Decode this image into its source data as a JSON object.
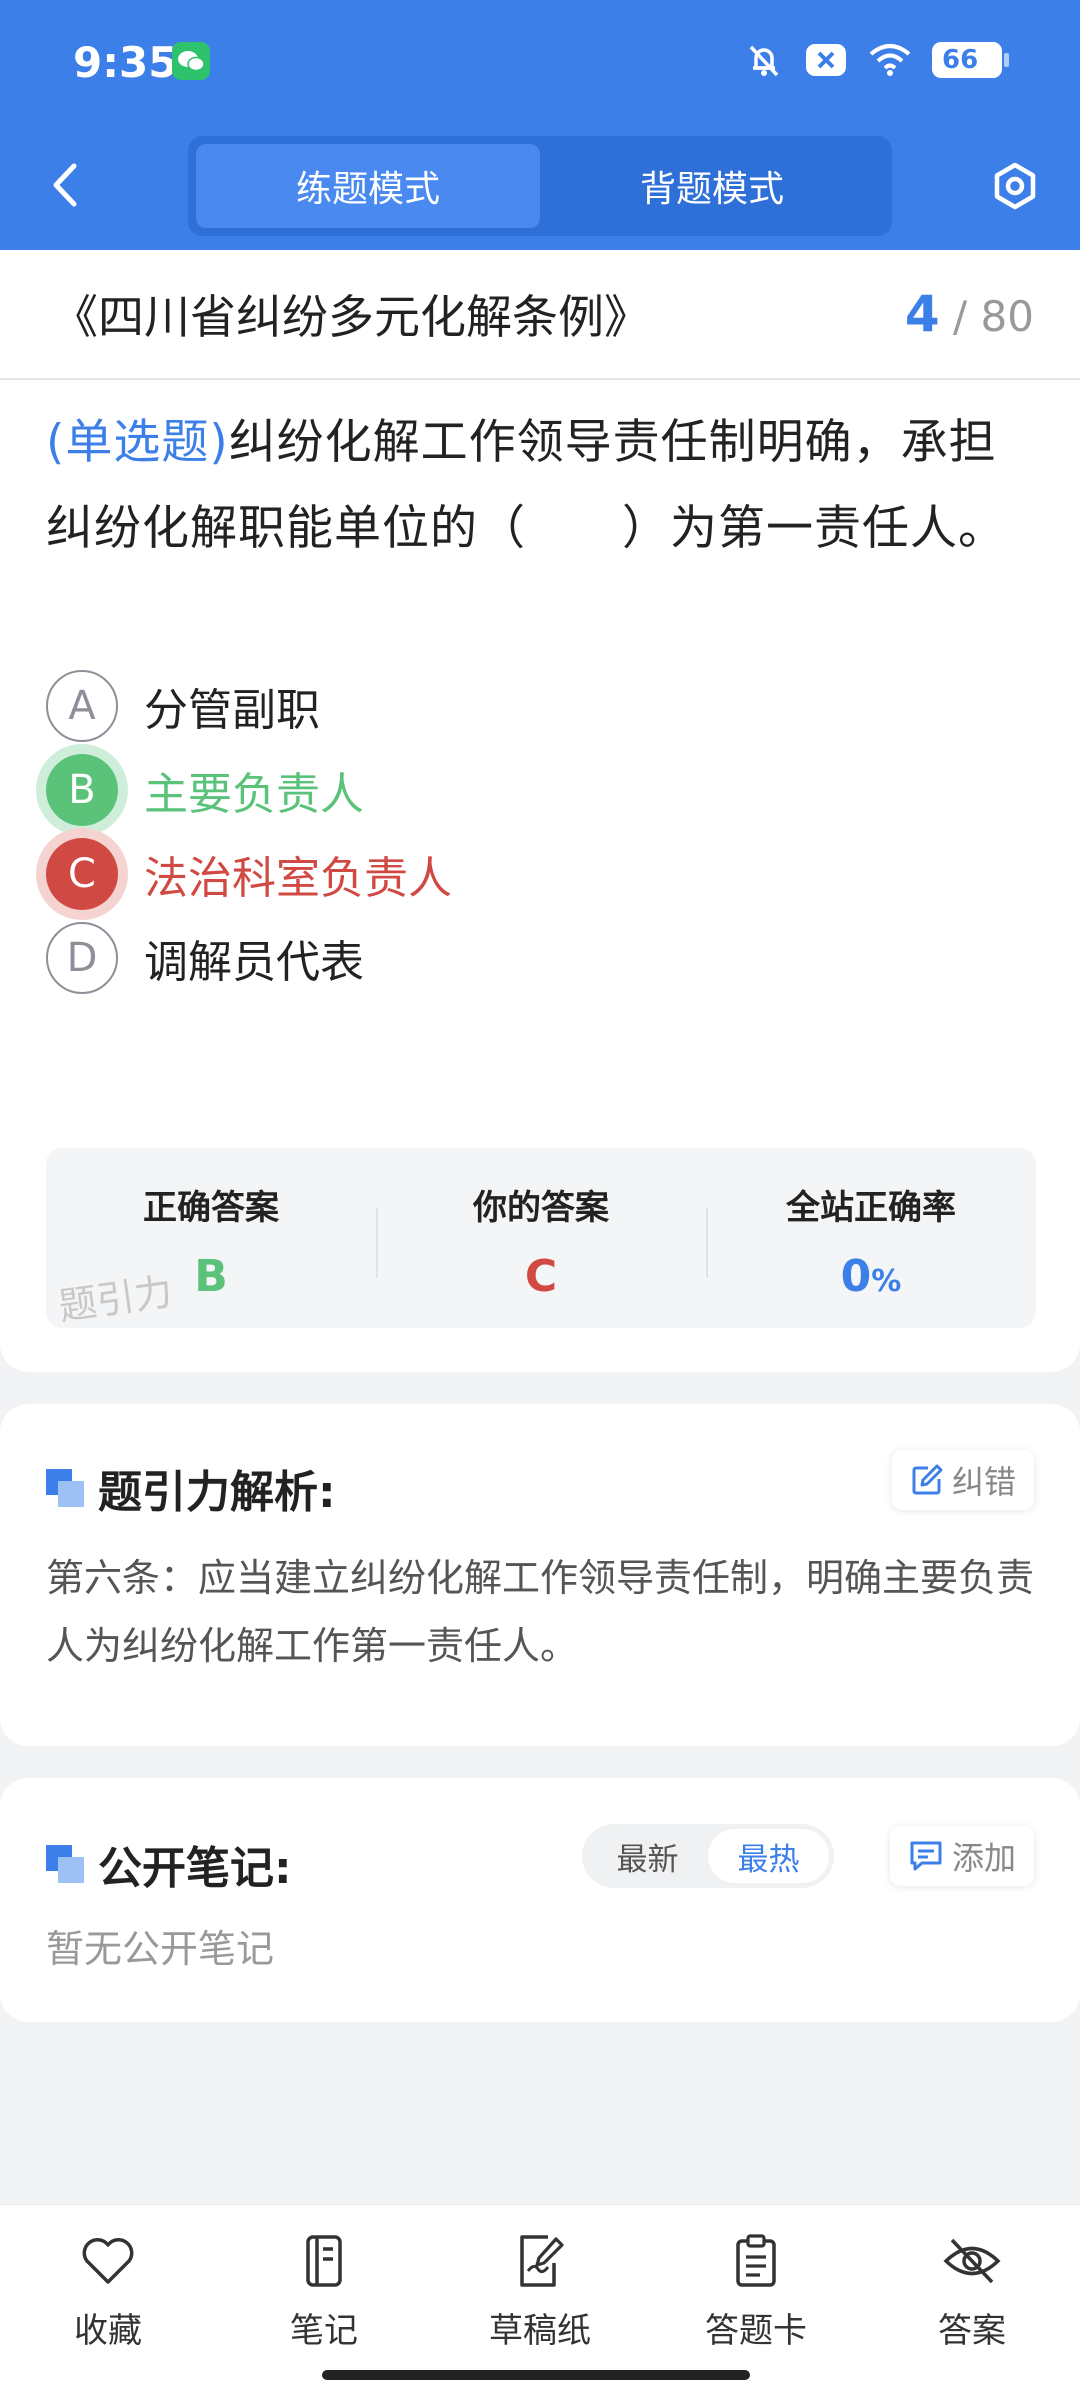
{
  "status": {
    "time": "9:35",
    "battery": "66"
  },
  "header": {
    "tabs": [
      {
        "label": "练题模式",
        "active": true
      },
      {
        "label": "背题模式",
        "active": false
      }
    ]
  },
  "question": {
    "book_title": "《四川省纠纷多元化解条例》",
    "current": "4",
    "separator": "/",
    "total": "80",
    "type_label": "(单选题)",
    "text": "纠纷化解工作领导责任制明确，承担纠纷化解职能单位的（　　）为第一责任人。",
    "options": [
      {
        "letter": "A",
        "text": "分管副职",
        "state": "normal"
      },
      {
        "letter": "B",
        "text": "主要负责人",
        "state": "correct"
      },
      {
        "letter": "C",
        "text": "法治科室负责人",
        "state": "wrong"
      },
      {
        "letter": "D",
        "text": "调解员代表",
        "state": "normal"
      }
    ]
  },
  "stats": {
    "correct_label": "正确答案",
    "correct_value": "B",
    "yours_label": "你的答案",
    "yours_value": "C",
    "rate_label": "全站正确率",
    "rate_value": "0",
    "rate_unit": "%",
    "watermark": "题引力"
  },
  "analysis": {
    "title": "题引力解析:",
    "report_label": "纠错",
    "text": "第六条：应当建立纠纷化解工作领导责任制，明确主要负责人为纠纷化解工作第一责任人。"
  },
  "notes": {
    "title": "公开笔记:",
    "sort_options": [
      {
        "label": "最新",
        "active": false
      },
      {
        "label": "最热",
        "active": true
      }
    ],
    "add_label": "添加",
    "empty_text": "暂无公开笔记"
  },
  "bottom_nav": [
    {
      "label": "收藏",
      "icon": "heart-icon"
    },
    {
      "label": "笔记",
      "icon": "notebook-icon"
    },
    {
      "label": "草稿纸",
      "icon": "draft-paper-icon"
    },
    {
      "label": "答题卡",
      "icon": "answer-sheet-icon"
    },
    {
      "label": "答案",
      "icon": "eye-off-icon"
    }
  ],
  "colors": {
    "primary": "#3d7fe8",
    "correct": "#5bc27a",
    "wrong": "#d04a43"
  }
}
